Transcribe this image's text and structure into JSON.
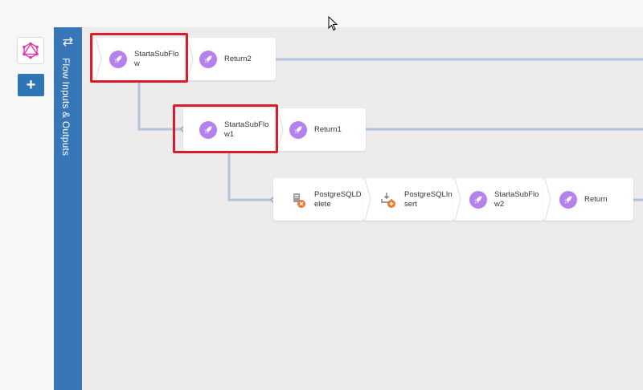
{
  "side_panel": {
    "title": "Flow Inputs & Outputs",
    "swap_icon": "⇄"
  },
  "toolbar": {
    "add_label": "+"
  },
  "colors": {
    "panel_blue": "#3776b7",
    "activity_purple": "#b681ef",
    "highlight_red": "#d81e2c",
    "connector": "#b4c3dd"
  },
  "flows": {
    "row1": [
      {
        "label": "StartaSubFlow",
        "icon": "rocket-icon"
      },
      {
        "label": "Return2",
        "icon": "rocket-icon"
      }
    ],
    "row2": [
      {
        "label": "StartaSubFlow1",
        "icon": "rocket-icon"
      },
      {
        "label": "Return1",
        "icon": "rocket-icon"
      }
    ],
    "row3": [
      {
        "label": "PostgreSQLDelete",
        "icon": "postgres-delete-icon"
      },
      {
        "label": "PostgreSQLInsert",
        "icon": "postgres-insert-icon"
      },
      {
        "label": "StartaSubFlow2",
        "icon": "rocket-icon"
      },
      {
        "label": "Return",
        "icon": "rocket-icon"
      }
    ]
  }
}
